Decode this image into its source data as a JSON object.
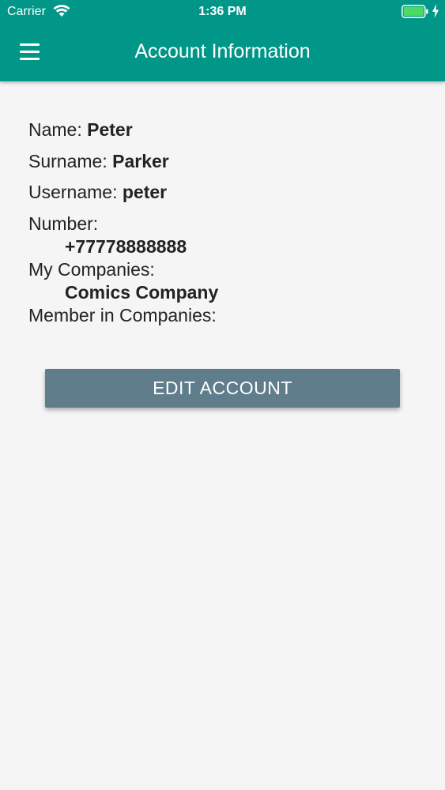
{
  "status_bar": {
    "carrier": "Carrier",
    "time": "1:36 PM",
    "wifi_icon": "wifi-icon",
    "battery_icon": "battery-icon",
    "charging_icon": "charging-icon",
    "battery_color": "#4cd964"
  },
  "header": {
    "title": "Account Information",
    "menu_icon": "hamburger-menu-icon",
    "color": "#009688"
  },
  "account": {
    "name_label": "Name:",
    "name_value": "Peter",
    "surname_label": "Surname:",
    "surname_value": "Parker",
    "username_label": "Username:",
    "username_value": "peter",
    "number_label": "Number:",
    "number_value": "+77778888888",
    "my_companies_label": "My Companies:",
    "my_companies": [
      "Comics Company"
    ],
    "member_in_companies_label": "Member in Companies:"
  },
  "actions": {
    "edit_account_label": "EDIT ACCOUNT",
    "button_color": "#607d8b"
  }
}
